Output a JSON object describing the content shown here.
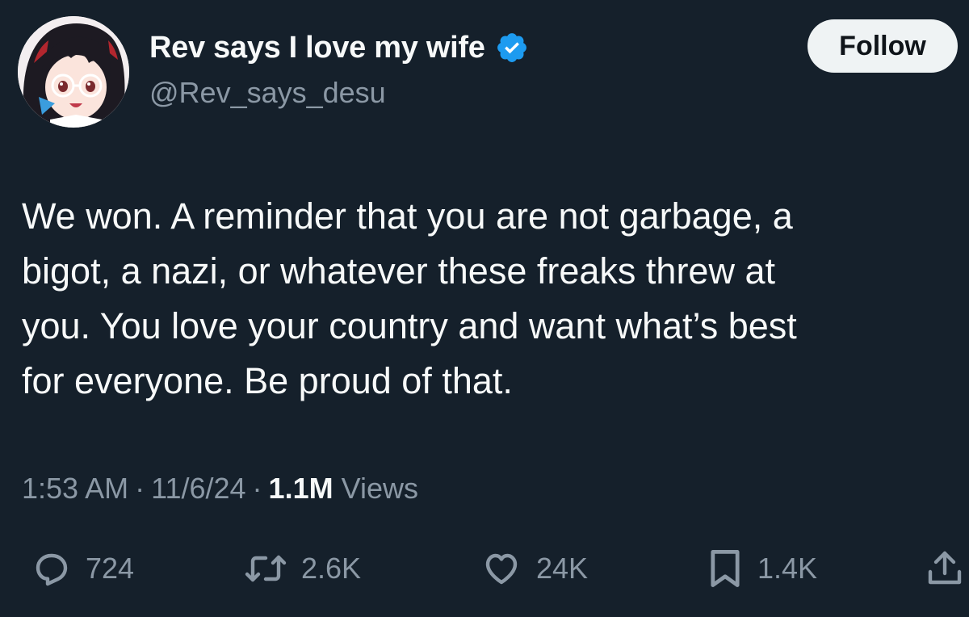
{
  "author": {
    "display_name": "Rev says I love my wife",
    "handle": "@Rev_says_desu",
    "verified": true,
    "avatar": "anime-girl-avatar"
  },
  "follow_label": "Follow",
  "tweet": {
    "lines": [
      "We won. A reminder that you are not garbage, a",
      "bigot, a nazi, or whatever these freaks threw at",
      "you. You love your country and want what’s best",
      "for everyone. Be proud of that."
    ]
  },
  "meta": {
    "time": "1:53 AM",
    "date": "11/6/24",
    "separator": "·",
    "views_count": "1.1M",
    "views_label": "Views"
  },
  "actions": {
    "replies": "724",
    "retweets": "2.6K",
    "likes": "24K",
    "bookmarks": "1.4K"
  },
  "colors": {
    "background": "#15202b",
    "text": "#f7f9f9",
    "secondary": "#8b98a5",
    "verified": "#1d9bf0",
    "follow_bg": "#eff3f4"
  }
}
